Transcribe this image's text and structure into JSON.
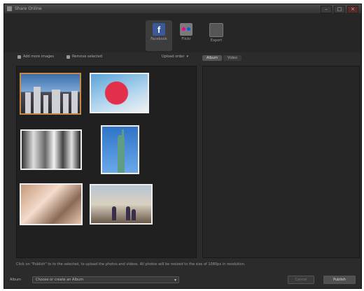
{
  "window": {
    "title": "Share Online"
  },
  "services": [
    {
      "id": "facebook",
      "label": "Facebook",
      "icon": "facebook-icon"
    },
    {
      "id": "flickr",
      "label": "Flickr",
      "icon": "flickr-icon"
    },
    {
      "id": "export",
      "label": "Export",
      "icon": "export-icon"
    }
  ],
  "toolbar": {
    "add_label": "Add more images",
    "remove_label": "Remove selected",
    "sort_label": "Upload order"
  },
  "right_tabs": [
    {
      "label": "Album",
      "active": true
    },
    {
      "label": "Video",
      "active": false
    }
  ],
  "status_text": "Click on \"Publish\" to to the selected, to upload the photos and videos. All photos will be resized to the size of 1080px in resolution.",
  "album": {
    "label": "Album",
    "value": "Choose or create an Album"
  },
  "buttons": {
    "cancel": "Cancel",
    "publish": "Publish"
  },
  "colors": {
    "accent": "#3b5998",
    "selection": "#c4884a"
  }
}
